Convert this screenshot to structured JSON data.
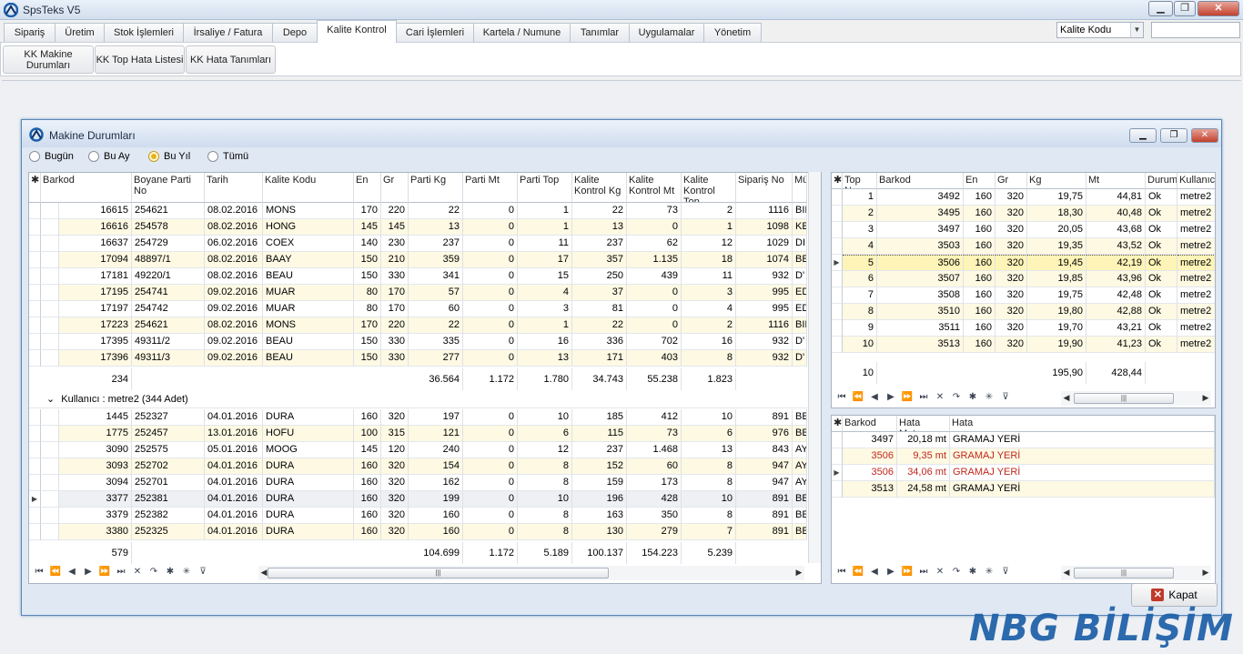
{
  "window": {
    "title": "SpsTeks V5"
  },
  "tabs": [
    "Sipariş",
    "Üretim",
    "Stok İşlemleri",
    "İrsaliye / Fatura",
    "Depo",
    "Kalite Kontrol",
    "Cari İşlemleri",
    "Kartela / Numune",
    "Tanımlar",
    "Uygulamalar",
    "Yönetim"
  ],
  "active_tab": "Kalite Kontrol",
  "search_combo": {
    "value": "Kalite Kodu"
  },
  "ribbon": {
    "btn1": "KK Makine Durumları",
    "btn2": "KK Top Hata Listesi",
    "btn3": "KK Hata Tanımları"
  },
  "child": {
    "title": "Makine Durumları",
    "filters": [
      "Bugün",
      "Bu Ay",
      "Bu Yıl",
      "Tümü"
    ],
    "selected_filter": "Bu Yıl"
  },
  "main_grid": {
    "columns": [
      "Barkod",
      "Boyane Parti No",
      "Tarih",
      "Kalite Kodu",
      "En",
      "Gr",
      "Parti Kg",
      "Parti Mt",
      "Parti Top",
      "Kalite Kontrol Kg",
      "Kalite Kontrol Mt",
      "Kalite Kontrol Top",
      "Sipariş No",
      "Mü"
    ],
    "group1_rows": [
      [
        "16615",
        "254621",
        "08.02.2016",
        "MONS",
        "170",
        "220",
        "22",
        "0",
        "1",
        "22",
        "73",
        "2",
        "1116",
        "BII"
      ],
      [
        "16616",
        "254578",
        "08.02.2016",
        "HONG",
        "145",
        "145",
        "13",
        "0",
        "1",
        "13",
        "0",
        "1",
        "1098",
        "KE"
      ],
      [
        "16637",
        "254729",
        "06.02.2016",
        "COEX",
        "140",
        "230",
        "237",
        "0",
        "11",
        "237",
        "62",
        "12",
        "1029",
        "DI"
      ],
      [
        "17094",
        "48897/1",
        "08.02.2016",
        "BAAY",
        "150",
        "210",
        "359",
        "0",
        "17",
        "357",
        "1.135",
        "18",
        "1074",
        "BE"
      ],
      [
        "17181",
        "49220/1",
        "08.02.2016",
        "BEAU",
        "150",
        "330",
        "341",
        "0",
        "15",
        "250",
        "439",
        "11",
        "932",
        "D'"
      ],
      [
        "17195",
        "254741",
        "09.02.2016",
        "MUAR",
        "80",
        "170",
        "57",
        "0",
        "4",
        "37",
        "0",
        "3",
        "995",
        "ED"
      ],
      [
        "17197",
        "254742",
        "09.02.2016",
        "MUAR",
        "80",
        "170",
        "60",
        "0",
        "3",
        "81",
        "0",
        "4",
        "995",
        "ED"
      ],
      [
        "17223",
        "254621",
        "08.02.2016",
        "MONS",
        "170",
        "220",
        "22",
        "0",
        "1",
        "22",
        "0",
        "2",
        "1116",
        "BII"
      ],
      [
        "17395",
        "49311/2",
        "09.02.2016",
        "BEAU",
        "150",
        "330",
        "335",
        "0",
        "16",
        "336",
        "702",
        "16",
        "932",
        "D'"
      ],
      [
        "17396",
        "49311/3",
        "09.02.2016",
        "BEAU",
        "150",
        "330",
        "277",
        "0",
        "13",
        "171",
        "403",
        "8",
        "932",
        "D'"
      ]
    ],
    "group1_summary": {
      "count": "234",
      "parti_kg": "36.564",
      "parti_mt": "1.172",
      "parti_top": "1.780",
      "kk_kg": "34.743",
      "kk_mt": "55.238",
      "kk_top": "1.823"
    },
    "group2_label": "Kullanıcı : metre2 (344 Adet)",
    "group2_rows": [
      [
        "1445",
        "252327",
        "04.01.2016",
        "DURA",
        "160",
        "320",
        "197",
        "0",
        "10",
        "185",
        "412",
        "10",
        "891",
        "BE"
      ],
      [
        "1775",
        "252457",
        "13.01.2016",
        "HOFU",
        "100",
        "315",
        "121",
        "0",
        "6",
        "115",
        "73",
        "6",
        "976",
        "BE"
      ],
      [
        "3090",
        "252575",
        "05.01.2016",
        "MOOG",
        "145",
        "120",
        "240",
        "0",
        "12",
        "237",
        "1.468",
        "13",
        "843",
        "AY"
      ],
      [
        "3093",
        "252702",
        "04.01.2016",
        "DURA",
        "160",
        "320",
        "154",
        "0",
        "8",
        "152",
        "60",
        "8",
        "947",
        "AY"
      ],
      [
        "3094",
        "252701",
        "04.01.2016",
        "DURA",
        "160",
        "320",
        "162",
        "0",
        "8",
        "159",
        "173",
        "8",
        "947",
        "AY"
      ],
      [
        "3377",
        "252381",
        "04.01.2016",
        "DURA",
        "160",
        "320",
        "199",
        "0",
        "10",
        "196",
        "428",
        "10",
        "891",
        "BE"
      ],
      [
        "3379",
        "252382",
        "04.01.2016",
        "DURA",
        "160",
        "320",
        "160",
        "0",
        "8",
        "163",
        "350",
        "8",
        "891",
        "BE"
      ],
      [
        "3380",
        "252325",
        "04.01.2016",
        "DURA",
        "160",
        "320",
        "160",
        "0",
        "8",
        "130",
        "279",
        "7",
        "891",
        "BE"
      ]
    ],
    "total_summary": {
      "count": "579",
      "parti_kg": "104.699",
      "parti_mt": "1.172",
      "parti_top": "5.189",
      "kk_kg": "100.137",
      "kk_mt": "154.223",
      "kk_top": "5.239"
    }
  },
  "top_grid": {
    "columns": [
      "Top No",
      "Barkod",
      "En",
      "Gr",
      "Kg",
      "Mt",
      "Durum",
      "Kullanıcı"
    ],
    "rows": [
      [
        "1",
        "3492",
        "160",
        "320",
        "19,75",
        "44,81",
        "Ok",
        "metre2"
      ],
      [
        "2",
        "3495",
        "160",
        "320",
        "18,30",
        "40,48",
        "Ok",
        "metre2"
      ],
      [
        "3",
        "3497",
        "160",
        "320",
        "20,05",
        "43,68",
        "Ok",
        "metre2"
      ],
      [
        "4",
        "3503",
        "160",
        "320",
        "19,35",
        "43,52",
        "Ok",
        "metre2"
      ],
      [
        "5",
        "3506",
        "160",
        "320",
        "19,45",
        "42,19",
        "Ok",
        "metre2"
      ],
      [
        "6",
        "3507",
        "160",
        "320",
        "19,85",
        "43,96",
        "Ok",
        "metre2"
      ],
      [
        "7",
        "3508",
        "160",
        "320",
        "19,75",
        "42,48",
        "Ok",
        "metre2"
      ],
      [
        "8",
        "3510",
        "160",
        "320",
        "19,80",
        "42,88",
        "Ok",
        "metre2"
      ],
      [
        "9",
        "3511",
        "160",
        "320",
        "19,70",
        "43,21",
        "Ok",
        "metre2"
      ],
      [
        "10",
        "3513",
        "160",
        "320",
        "19,90",
        "41,23",
        "Ok",
        "metre2"
      ]
    ],
    "selected_index": 4,
    "summary": {
      "count": "10",
      "kg": "195,90",
      "mt": "428,44"
    }
  },
  "defect_grid": {
    "columns": [
      "Barkod",
      "Hata Metre",
      "Hata"
    ],
    "rows": [
      [
        "3497",
        "20,18 mt",
        "GRAMAJ YERİ"
      ],
      [
        "3506",
        "9,35 mt",
        "GRAMAJ YERİ"
      ],
      [
        "3506",
        "34,06 mt",
        "GRAMAJ YERİ"
      ],
      [
        "3513",
        "24,58 mt",
        "GRAMAJ YERİ"
      ]
    ]
  },
  "close_button": "Kapat",
  "watermark": "NBG BİLİŞİM",
  "colors": {
    "row_alt": "#fdf9e3",
    "row_selected": "#fff4b8",
    "defect_red": "#c0281d",
    "title_blue": "#1c5fa8"
  }
}
